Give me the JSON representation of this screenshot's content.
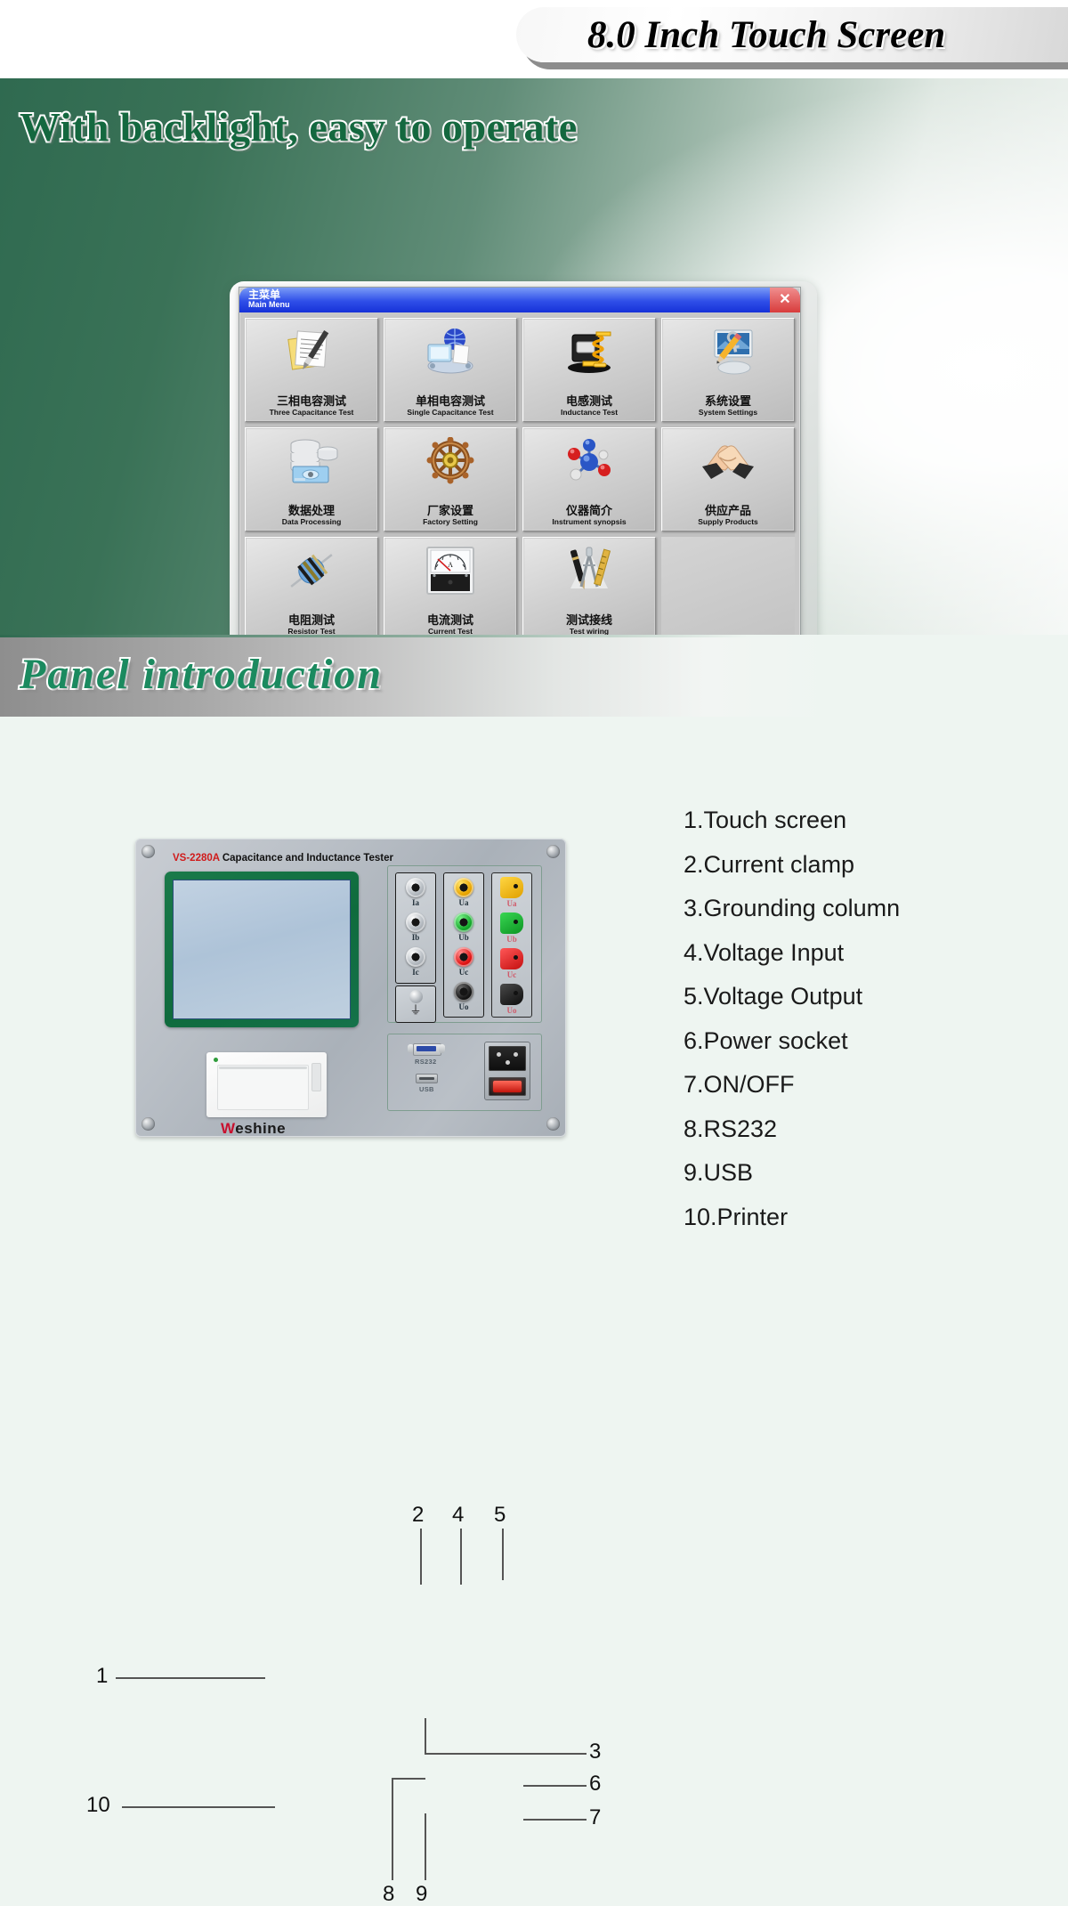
{
  "header": {
    "title": "8.0 Inch Touch Screen"
  },
  "screen_section": {
    "headline": "With backlight, easy to operate",
    "dialog": {
      "title_cn": "主菜单",
      "title_en": "Main Menu",
      "close_label": "✕",
      "menu_items": [
        {
          "cn": "三相电容测试",
          "en": "Three Capacitance Test",
          "icon": "document-pen-icon"
        },
        {
          "cn": "单相电容测试",
          "en": "Single Capacitance Test",
          "icon": "network-globe-icon"
        },
        {
          "cn": "电感测试",
          "en": "Inductance Test",
          "icon": "coil-spring-icon"
        },
        {
          "cn": "系统设置",
          "en": "System Settings",
          "icon": "monitor-keys-icon"
        },
        {
          "cn": "数据处理",
          "en": "Data Processing",
          "icon": "database-disk-icon"
        },
        {
          "cn": "厂家设置",
          "en": "Factory Setting",
          "icon": "ship-wheel-icon"
        },
        {
          "cn": "仪器简介",
          "en": "Instrument synopsis",
          "icon": "molecule-icon"
        },
        {
          "cn": "供应产品",
          "en": "Supply Products",
          "icon": "handshake-icon"
        },
        {
          "cn": "电阻测试",
          "en": "Resistor  Test",
          "icon": "resistor-icon"
        },
        {
          "cn": "电流测试",
          "en": "Current Test",
          "icon": "ammeter-icon"
        },
        {
          "cn": "测试接线",
          "en": "Test wiring",
          "icon": "pen-compass-icon"
        }
      ]
    }
  },
  "panel_section": {
    "headline": "Panel introduction",
    "device": {
      "model": "VS-2280A",
      "model_desc": "Capacitance and Inductance Tester",
      "brand_first": "W",
      "brand_rest": "eshine",
      "current_labels": [
        "Ia",
        "Ib",
        "Ic"
      ],
      "ground_symbol": "⏚",
      "voltage_in_labels": [
        "Ua",
        "Ub",
        "Uc",
        "Uo"
      ],
      "voltage_out_labels": [
        "Ua",
        "Ub",
        "Uc",
        "Uo"
      ],
      "rs232_label": "RS232",
      "usb_label": "USB"
    },
    "callouts": [
      "1",
      "2",
      "3",
      "4",
      "5",
      "6",
      "7",
      "8",
      "9",
      "10"
    ],
    "legend": [
      "1.Touch screen",
      "2.Current clamp",
      "3.Grounding column",
      "4.Voltage Input",
      "5.Voltage Output",
      "6.Power socket",
      "7.ON/OFF",
      "8.RS232",
      "9.USB",
      "10.Printer"
    ]
  },
  "colors": {
    "green_text": "#14683f",
    "panel_green": "#1b8a5f",
    "brand_red": "#c8102e",
    "model_red": "#d01b1b",
    "titlebar_blue": "#1631d8",
    "close_red": "#d83c3c"
  }
}
